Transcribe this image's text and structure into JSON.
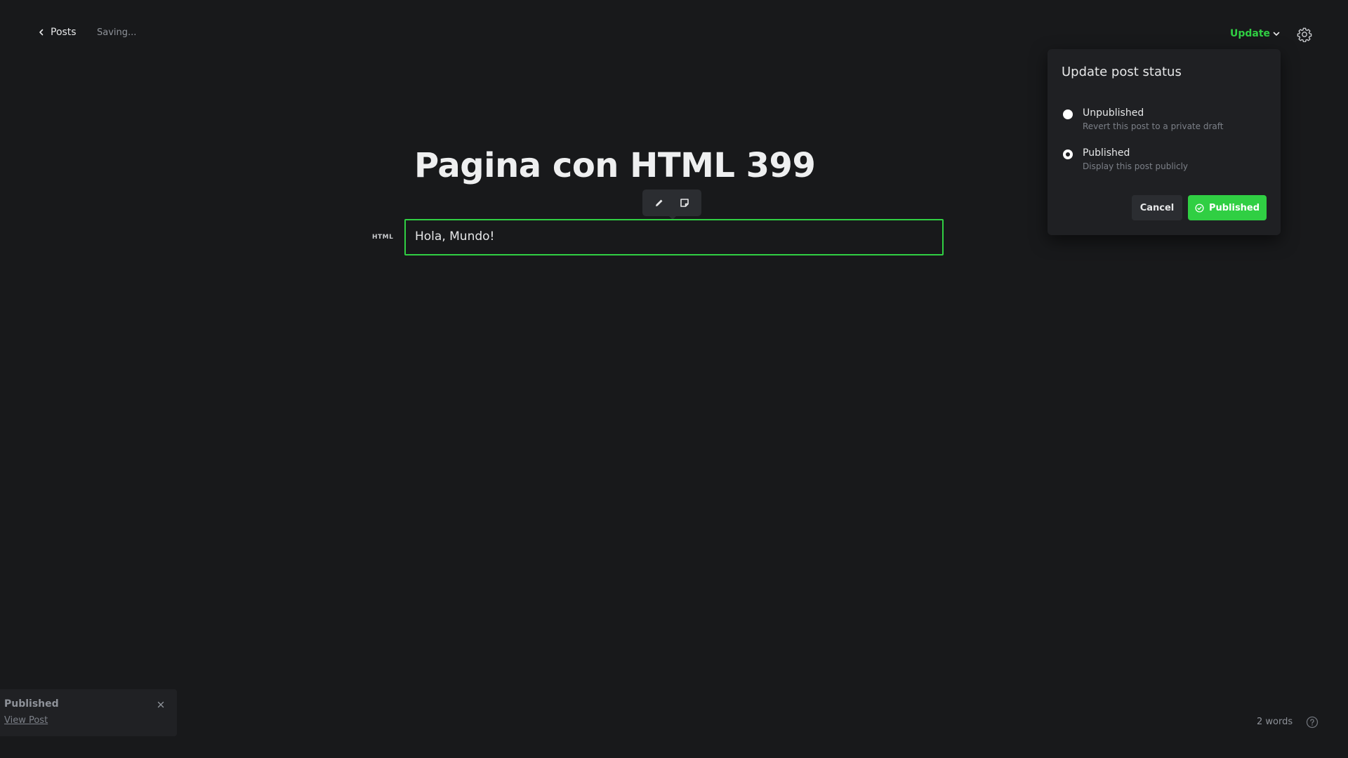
{
  "header": {
    "back_label": "Posts",
    "status_text": "Saving...",
    "update_label": "Update"
  },
  "editor": {
    "title": "Pagina con HTML 399",
    "card_label": "HTML",
    "card_content": "Hola, Mundo!",
    "toolbar_icons": [
      "pencil-icon",
      "snippet-icon"
    ]
  },
  "status_popover": {
    "title": "Update post status",
    "options": [
      {
        "label": "Unpublished",
        "description": "Revert this post to a private draft",
        "selected": false
      },
      {
        "label": "Published",
        "description": "Display this post publicly",
        "selected": true
      }
    ],
    "cancel_label": "Cancel",
    "confirm_label": "Published"
  },
  "notification": {
    "title": "Published",
    "link_label": "View Post"
  },
  "footer": {
    "word_count": "2 words"
  },
  "colors": {
    "background": "#18191b",
    "accent_green": "#30cf43",
    "popover_bg": "#1f2023"
  }
}
